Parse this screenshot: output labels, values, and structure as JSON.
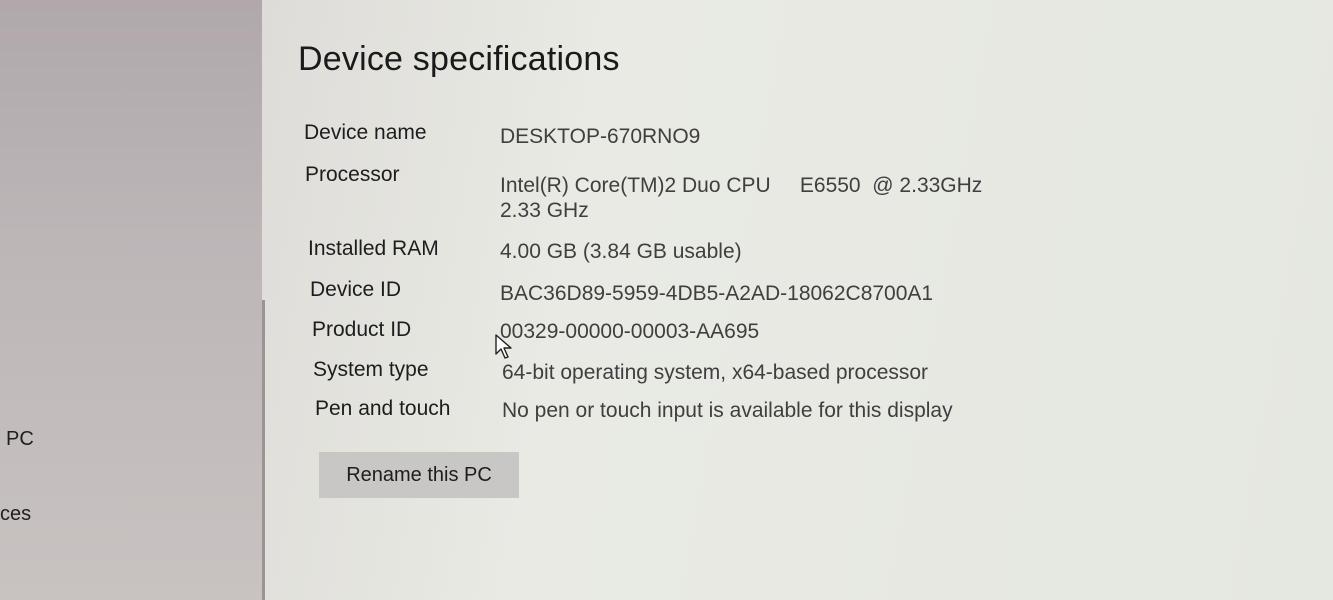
{
  "sidebar": {
    "items": [
      {
        "label": "PC"
      },
      {
        "label": "ces"
      }
    ]
  },
  "main": {
    "title": "Device specifications",
    "specs": [
      {
        "label": "Device name",
        "value": "DESKTOP-670RNO9"
      },
      {
        "label": "Processor",
        "value": "Intel(R) Core(TM)2 Duo CPU     E6550  @ 2.33GHz",
        "value2": "2.33 GHz"
      },
      {
        "label": "Installed RAM",
        "value": "4.00 GB (3.84 GB usable)"
      },
      {
        "label": "Device ID",
        "value": "BAC36D89-5959-4DB5-A2AD-18062C8700A1"
      },
      {
        "label": "Product ID",
        "value": "00329-00000-00003-AA695"
      },
      {
        "label": "System type",
        "value": "64-bit operating system, x64-based processor"
      },
      {
        "label": "Pen and touch",
        "value": "No pen or touch input is available for this display"
      }
    ],
    "rename_button": "Rename this PC"
  },
  "icons": {
    "cursor": "mouse-pointer-icon"
  }
}
